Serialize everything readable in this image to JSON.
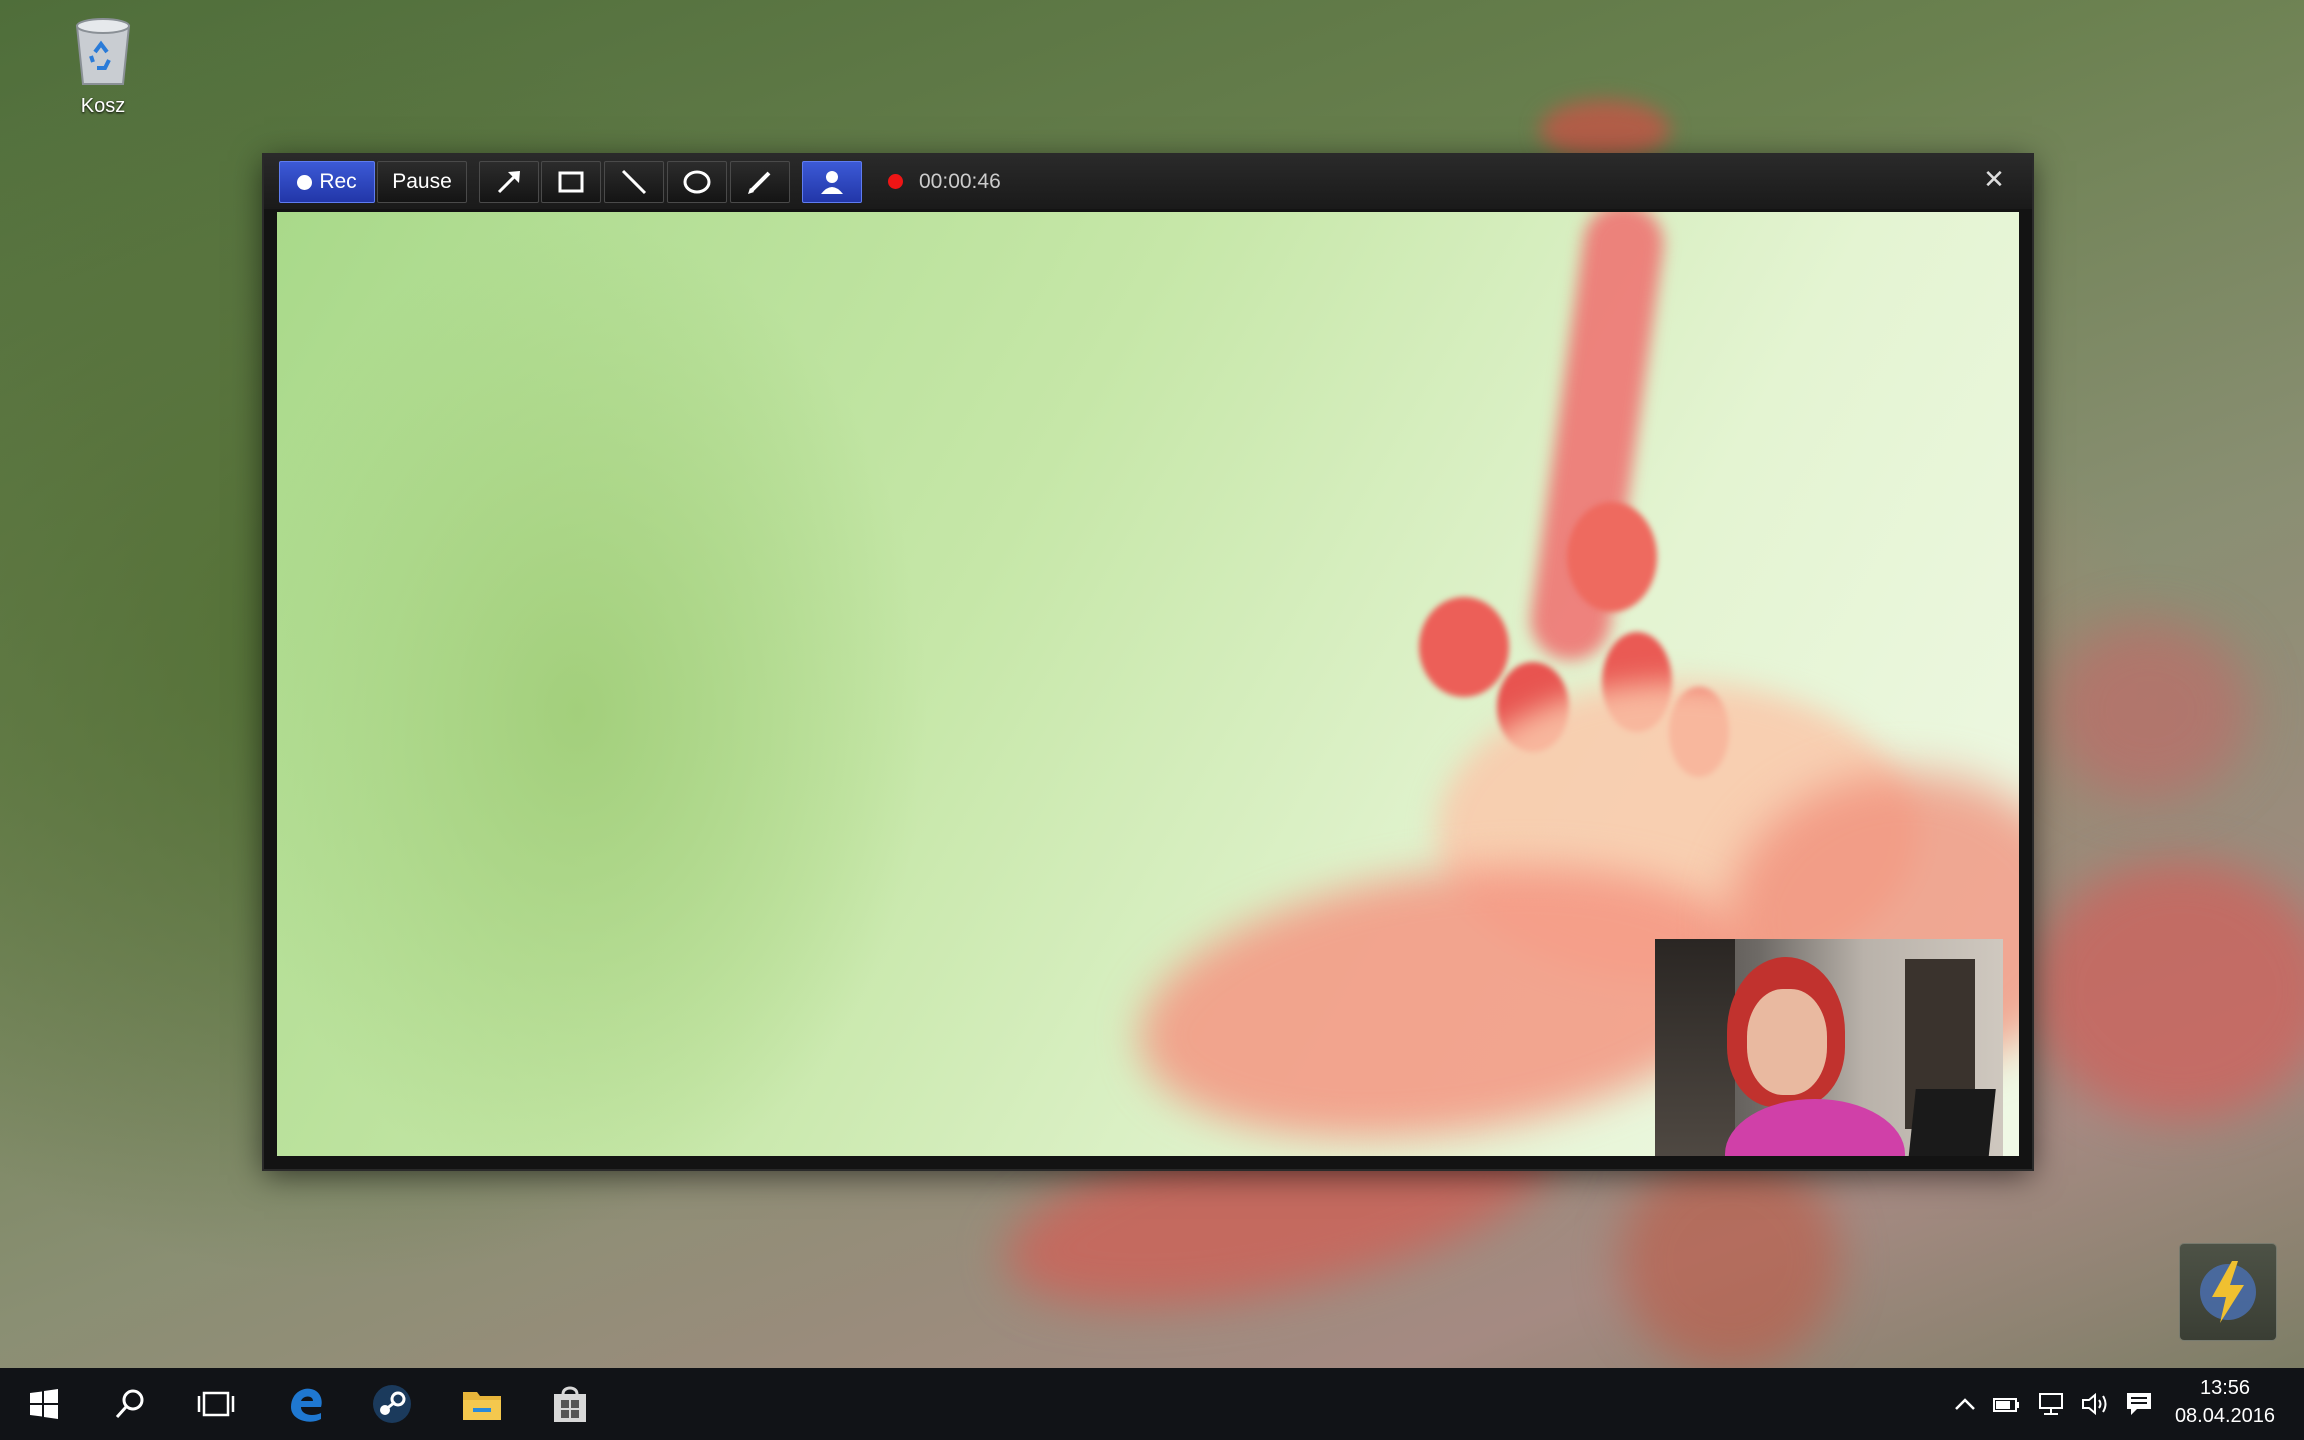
{
  "desktop": {
    "recycle_bin_label": "Kosz"
  },
  "recorder": {
    "rec_label": "Rec",
    "pause_label": "Pause",
    "timer": "00:00:46",
    "close_glyph": "✕",
    "tools": [
      "arrow-icon",
      "rectangle-icon",
      "line-icon",
      "ellipse-icon",
      "pen-icon",
      "webcam-person-icon"
    ],
    "accent_color": "#2a40b8",
    "record_indicator_color": "#ee1515"
  },
  "taskbar": {
    "apps": [
      "windows-start-icon",
      "search-icon",
      "task-view-icon",
      "edge-icon",
      "steam-icon",
      "file-explorer-icon",
      "store-icon"
    ],
    "tray_icons": [
      "chevron-up-icon",
      "battery-icon",
      "network-icon",
      "volume-icon",
      "action-center-icon"
    ],
    "time": "13:56",
    "date": "08.04.2016"
  }
}
